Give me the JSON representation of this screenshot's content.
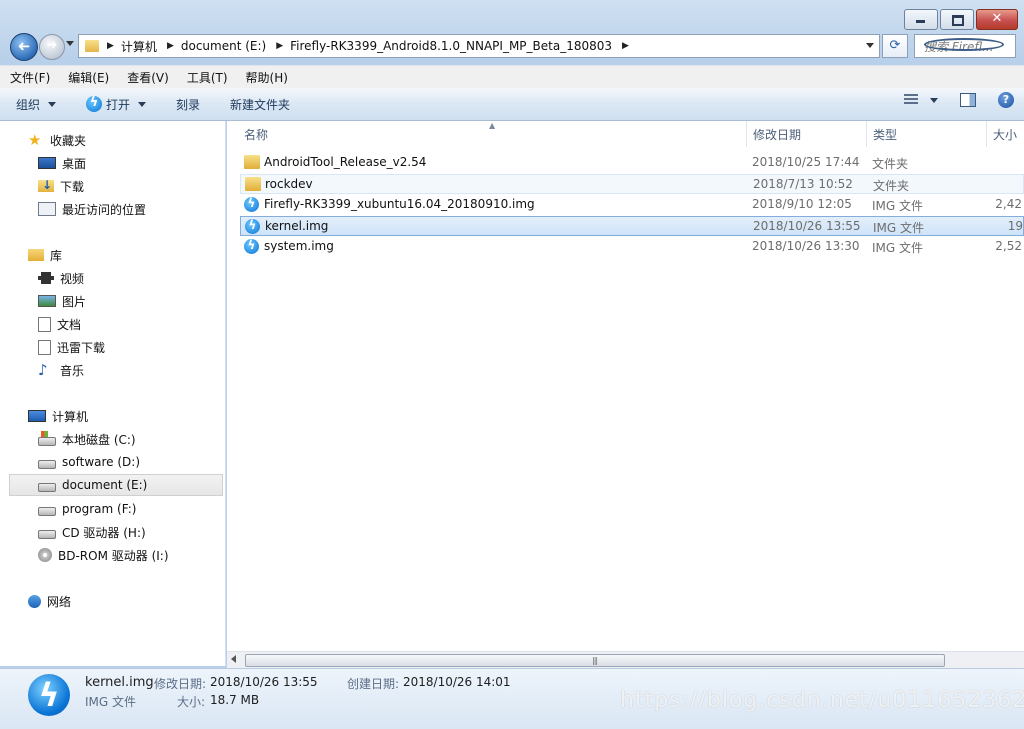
{
  "window": {
    "caption": {
      "minimize": "minimize",
      "maximize": "maximize",
      "close": "close"
    }
  },
  "address": {
    "crumbs": [
      "计算机",
      "document (E:)",
      "Firefly-RK3399_Android8.1.0_NNAPI_MP_Beta_180803"
    ],
    "search_placeholder": "搜索 Firefl..."
  },
  "menu": [
    "文件(F)",
    "编辑(E)",
    "查看(V)",
    "工具(T)",
    "帮助(H)"
  ],
  "toolbar": {
    "organize": "组织",
    "open": "打开",
    "burn": "刻录",
    "new_folder": "新建文件夹"
  },
  "nav": {
    "favorites": {
      "title": "收藏夹",
      "items": [
        "桌面",
        "下载",
        "最近访问的位置"
      ]
    },
    "libraries": {
      "title": "库",
      "items": [
        "视频",
        "图片",
        "文档",
        "迅雷下载",
        "音乐"
      ]
    },
    "computer": {
      "title": "计算机",
      "items": [
        "本地磁盘 (C:)",
        "software (D:)",
        "document (E:)",
        "program (F:)",
        "CD 驱动器 (H:)",
        "BD-ROM 驱动器 (I:)"
      ]
    },
    "network": {
      "title": "网络"
    }
  },
  "columns": {
    "name": "名称",
    "date": "修改日期",
    "type": "类型",
    "size": "大小"
  },
  "files": [
    {
      "name": "AndroidTool_Release_v2.54",
      "date": "2018/10/25 17:44",
      "type": "文件夹",
      "size": ""
    },
    {
      "name": "rockdev",
      "date": "2018/7/13 10:52",
      "type": "文件夹",
      "size": ""
    },
    {
      "name": "Firefly-RK3399_xubuntu16.04_20180910.img",
      "date": "2018/9/10 12:05",
      "type": "IMG 文件",
      "size": "2,42"
    },
    {
      "name": "kernel.img",
      "date": "2018/10/26 13:55",
      "type": "IMG 文件",
      "size": "19"
    },
    {
      "name": "system.img",
      "date": "2018/10/26 13:30",
      "type": "IMG 文件",
      "size": "2,52"
    }
  ],
  "details": {
    "filename": "kernel.img",
    "filetype": "IMG 文件",
    "modified_label": "修改日期:",
    "modified_value": "2018/10/26 13:55",
    "created_label": "创建日期:",
    "created_value": "2018/10/26 14:01",
    "size_label": "大小:",
    "size_value": "18.7 MB"
  },
  "watermark": "https://blog.csdn.net/u011652362"
}
